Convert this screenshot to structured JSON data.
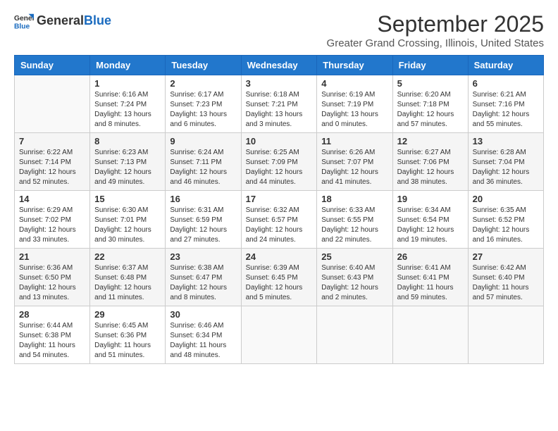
{
  "logo": {
    "general": "General",
    "blue": "Blue"
  },
  "header": {
    "month": "September 2025",
    "subtitle": "Greater Grand Crossing, Illinois, United States"
  },
  "weekdays": [
    "Sunday",
    "Monday",
    "Tuesday",
    "Wednesday",
    "Thursday",
    "Friday",
    "Saturday"
  ],
  "weeks": [
    [
      {
        "day": "",
        "info": ""
      },
      {
        "day": "1",
        "info": "Sunrise: 6:16 AM\nSunset: 7:24 PM\nDaylight: 13 hours\nand 8 minutes."
      },
      {
        "day": "2",
        "info": "Sunrise: 6:17 AM\nSunset: 7:23 PM\nDaylight: 13 hours\nand 6 minutes."
      },
      {
        "day": "3",
        "info": "Sunrise: 6:18 AM\nSunset: 7:21 PM\nDaylight: 13 hours\nand 3 minutes."
      },
      {
        "day": "4",
        "info": "Sunrise: 6:19 AM\nSunset: 7:19 PM\nDaylight: 13 hours\nand 0 minutes."
      },
      {
        "day": "5",
        "info": "Sunrise: 6:20 AM\nSunset: 7:18 PM\nDaylight: 12 hours\nand 57 minutes."
      },
      {
        "day": "6",
        "info": "Sunrise: 6:21 AM\nSunset: 7:16 PM\nDaylight: 12 hours\nand 55 minutes."
      }
    ],
    [
      {
        "day": "7",
        "info": "Sunrise: 6:22 AM\nSunset: 7:14 PM\nDaylight: 12 hours\nand 52 minutes."
      },
      {
        "day": "8",
        "info": "Sunrise: 6:23 AM\nSunset: 7:13 PM\nDaylight: 12 hours\nand 49 minutes."
      },
      {
        "day": "9",
        "info": "Sunrise: 6:24 AM\nSunset: 7:11 PM\nDaylight: 12 hours\nand 46 minutes."
      },
      {
        "day": "10",
        "info": "Sunrise: 6:25 AM\nSunset: 7:09 PM\nDaylight: 12 hours\nand 44 minutes."
      },
      {
        "day": "11",
        "info": "Sunrise: 6:26 AM\nSunset: 7:07 PM\nDaylight: 12 hours\nand 41 minutes."
      },
      {
        "day": "12",
        "info": "Sunrise: 6:27 AM\nSunset: 7:06 PM\nDaylight: 12 hours\nand 38 minutes."
      },
      {
        "day": "13",
        "info": "Sunrise: 6:28 AM\nSunset: 7:04 PM\nDaylight: 12 hours\nand 36 minutes."
      }
    ],
    [
      {
        "day": "14",
        "info": "Sunrise: 6:29 AM\nSunset: 7:02 PM\nDaylight: 12 hours\nand 33 minutes."
      },
      {
        "day": "15",
        "info": "Sunrise: 6:30 AM\nSunset: 7:01 PM\nDaylight: 12 hours\nand 30 minutes."
      },
      {
        "day": "16",
        "info": "Sunrise: 6:31 AM\nSunset: 6:59 PM\nDaylight: 12 hours\nand 27 minutes."
      },
      {
        "day": "17",
        "info": "Sunrise: 6:32 AM\nSunset: 6:57 PM\nDaylight: 12 hours\nand 24 minutes."
      },
      {
        "day": "18",
        "info": "Sunrise: 6:33 AM\nSunset: 6:55 PM\nDaylight: 12 hours\nand 22 minutes."
      },
      {
        "day": "19",
        "info": "Sunrise: 6:34 AM\nSunset: 6:54 PM\nDaylight: 12 hours\nand 19 minutes."
      },
      {
        "day": "20",
        "info": "Sunrise: 6:35 AM\nSunset: 6:52 PM\nDaylight: 12 hours\nand 16 minutes."
      }
    ],
    [
      {
        "day": "21",
        "info": "Sunrise: 6:36 AM\nSunset: 6:50 PM\nDaylight: 12 hours\nand 13 minutes."
      },
      {
        "day": "22",
        "info": "Sunrise: 6:37 AM\nSunset: 6:48 PM\nDaylight: 12 hours\nand 11 minutes."
      },
      {
        "day": "23",
        "info": "Sunrise: 6:38 AM\nSunset: 6:47 PM\nDaylight: 12 hours\nand 8 minutes."
      },
      {
        "day": "24",
        "info": "Sunrise: 6:39 AM\nSunset: 6:45 PM\nDaylight: 12 hours\nand 5 minutes."
      },
      {
        "day": "25",
        "info": "Sunrise: 6:40 AM\nSunset: 6:43 PM\nDaylight: 12 hours\nand 2 minutes."
      },
      {
        "day": "26",
        "info": "Sunrise: 6:41 AM\nSunset: 6:41 PM\nDaylight: 11 hours\nand 59 minutes."
      },
      {
        "day": "27",
        "info": "Sunrise: 6:42 AM\nSunset: 6:40 PM\nDaylight: 11 hours\nand 57 minutes."
      }
    ],
    [
      {
        "day": "28",
        "info": "Sunrise: 6:44 AM\nSunset: 6:38 PM\nDaylight: 11 hours\nand 54 minutes."
      },
      {
        "day": "29",
        "info": "Sunrise: 6:45 AM\nSunset: 6:36 PM\nDaylight: 11 hours\nand 51 minutes."
      },
      {
        "day": "30",
        "info": "Sunrise: 6:46 AM\nSunset: 6:34 PM\nDaylight: 11 hours\nand 48 minutes."
      },
      {
        "day": "",
        "info": ""
      },
      {
        "day": "",
        "info": ""
      },
      {
        "day": "",
        "info": ""
      },
      {
        "day": "",
        "info": ""
      }
    ]
  ]
}
